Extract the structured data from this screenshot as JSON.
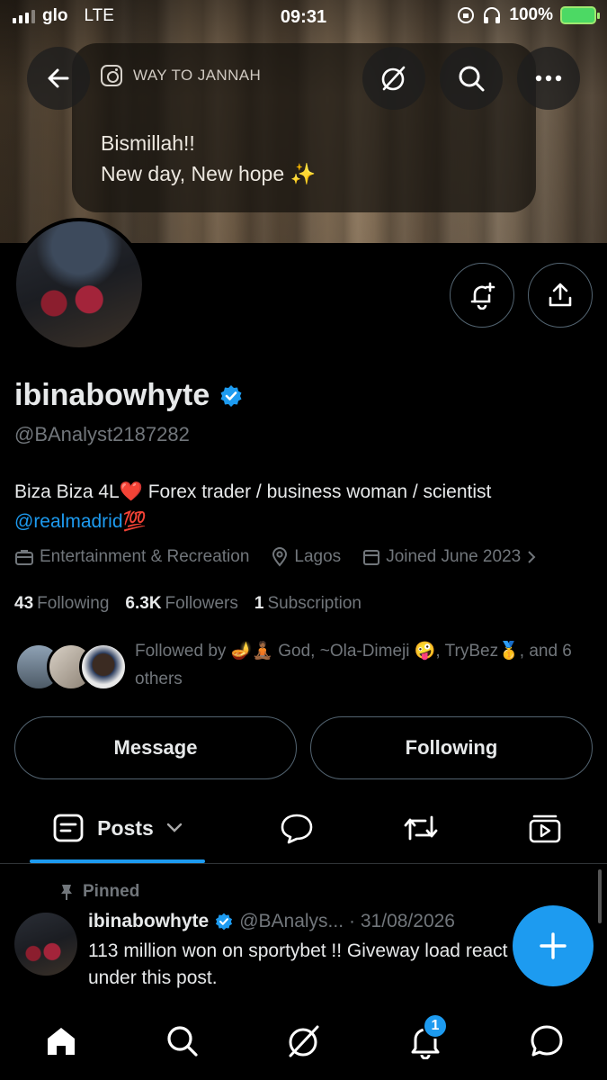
{
  "status_bar": {
    "carrier": "glo",
    "network": "LTE",
    "time": "09:31",
    "battery": "100%"
  },
  "banner": {
    "brand": "WAY TO JANNAH",
    "line1": "Bismillah!!",
    "line2": "New day, New hope ✨"
  },
  "profile": {
    "display_name": "ibinabowhyte",
    "handle": "@BAnalyst2187282",
    "bio_text": "Biza Biza 4L❤️ Forex trader / business woman / scientist",
    "bio_link": "@realmadrid",
    "bio_emoji": "💯",
    "category": "Entertainment & Recreation",
    "location": "Lagos",
    "joined": "Joined June 2023",
    "following_count": "43",
    "following_label": "Following",
    "followers_count": "6.3K",
    "followers_label": "Followers",
    "subscription_count": "1",
    "subscription_label": "Subscription",
    "followed_by": "Followed by 🪔🧘🏾 God, ~Ola-Dimeji 🤪, TryBez🥇, and 6 others"
  },
  "actions": {
    "message": "Message",
    "following": "Following"
  },
  "tabs": {
    "posts": "Posts"
  },
  "post": {
    "pinned_label": "Pinned",
    "author": "ibinabowhyte",
    "handle": "@BAnalys...",
    "date": "· 31/08/2026",
    "text": "113 million won on sportybet !! Giveway load react under this post."
  },
  "nav": {
    "notifications_badge": "1"
  },
  "colors": {
    "accent": "#1d9bf0",
    "background": "#000000",
    "muted": "#71767b"
  }
}
